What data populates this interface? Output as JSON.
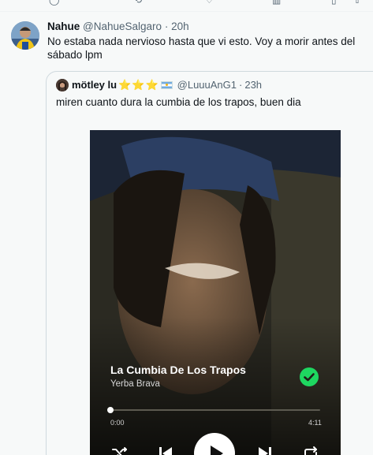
{
  "tweet": {
    "name": "Nahue",
    "handle": "@NahueSalgaro",
    "dot": "·",
    "time": "20h",
    "text": "No estaba nada nervioso hasta que vi esto. Voy a morir antes del sábado lpm"
  },
  "quote": {
    "name": "mötley lu",
    "stars": "⭐⭐⭐",
    "handle": "@LuuuAnG1",
    "dot": "·",
    "time": "23h",
    "text": "miren cuanto dura la cumbia de los trapos, buen dia"
  },
  "player": {
    "title": "La Cumbia De Los Trapos",
    "artist": "Yerba Brava",
    "elapsed": "0:00",
    "duration": "4:11",
    "progress": 0.0
  },
  "colors": {
    "accent_green": "#1ed760",
    "text_primary": "#0f1419",
    "text_secondary": "#536471",
    "border": "#cfd9de"
  },
  "icons": {
    "top_strip": [
      "reply-icon",
      "retweet-icon",
      "like-icon",
      "views-icon",
      "bookmark-icon",
      "share-icon"
    ],
    "controls": [
      "shuffle-icon",
      "previous-icon",
      "play-icon",
      "next-icon",
      "repeat-icon"
    ],
    "saved": "check-icon"
  }
}
